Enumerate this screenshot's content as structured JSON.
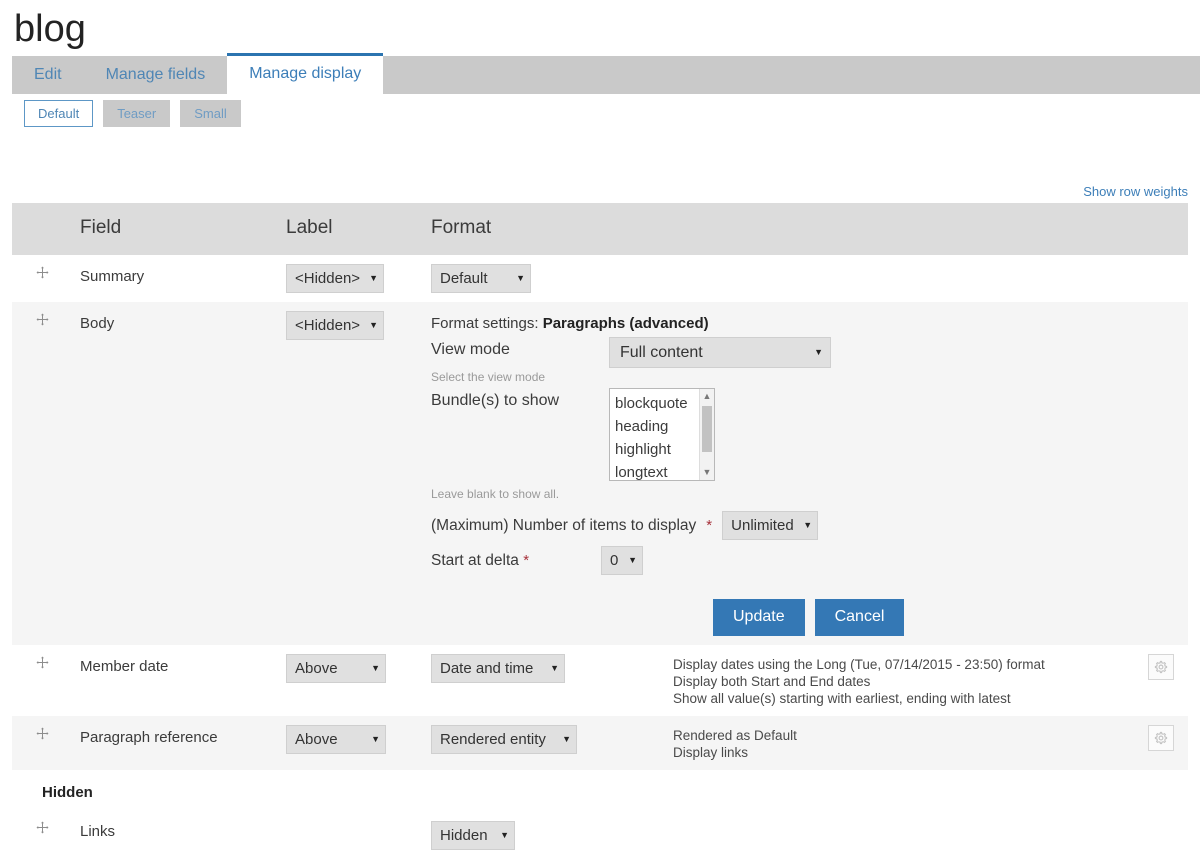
{
  "page": {
    "title": "blog"
  },
  "primary_tabs": [
    {
      "label": "Edit",
      "active": false
    },
    {
      "label": "Manage fields",
      "active": false
    },
    {
      "label": "Manage display",
      "active": true
    }
  ],
  "secondary_tabs": [
    {
      "label": "Default",
      "active": true
    },
    {
      "label": "Teaser",
      "active": false
    },
    {
      "label": "Small",
      "active": false
    }
  ],
  "row_weights_link": "Show row weights",
  "table": {
    "headers": {
      "field": "Field",
      "label": "Label",
      "format": "Format"
    },
    "rows": [
      {
        "field": "Summary",
        "label_select": "<Hidden>",
        "format_select": "Default",
        "summary": []
      },
      {
        "field": "Body",
        "label_select": "<Hidden>",
        "format_select": "",
        "summary": []
      },
      {
        "field": "Member date",
        "label_select": "Above",
        "format_select": "Date and time",
        "summary": [
          "Display dates using the Long (Tue, 07/14/2015 - 23:50) format",
          "Display both Start and End dates",
          "Show all value(s) starting with earliest, ending with latest"
        ]
      },
      {
        "field": "Paragraph reference",
        "label_select": "Above",
        "format_select": "Rendered entity",
        "summary": [
          "Rendered as Default",
          "Display links"
        ]
      }
    ],
    "region_hidden_title": "Hidden",
    "hidden_rows": [
      {
        "field": "Links",
        "format_select": "Hidden"
      }
    ]
  },
  "body_settings": {
    "title_prefix": "Format settings: ",
    "title_plugin": "Paragraphs (advanced)",
    "view_mode_label": "View mode",
    "view_mode_value": "Full content",
    "view_mode_desc": "Select the view mode",
    "bundles_label": "Bundle(s) to show",
    "bundles_options": [
      "blockquote",
      "heading",
      "highlight",
      "longtext"
    ],
    "bundles_desc": "Leave blank to show all.",
    "max_items_label": "(Maximum) Number of items to display",
    "max_items_required": "*",
    "max_items_value": "Unlimited",
    "delta_label": "Start at delta",
    "delta_required": "*",
    "delta_value": "0",
    "update_button": "Update",
    "cancel_button": "Cancel"
  },
  "icons": {
    "drag_handle": "drag-handle-icon",
    "caret_down": "▾",
    "scroll_up": "▲",
    "scroll_down": "▼",
    "gear": "gear-icon"
  },
  "colors": {
    "accent_blue": "#3478b5",
    "tab_active_border": "#2b74b0",
    "link_blue": "#3c7eb8",
    "required_red": "#a6303a",
    "header_gray": "#dcdcdc",
    "tabbar_gray": "#c9c9c9",
    "row_alt_gray": "#f5f5f5"
  }
}
